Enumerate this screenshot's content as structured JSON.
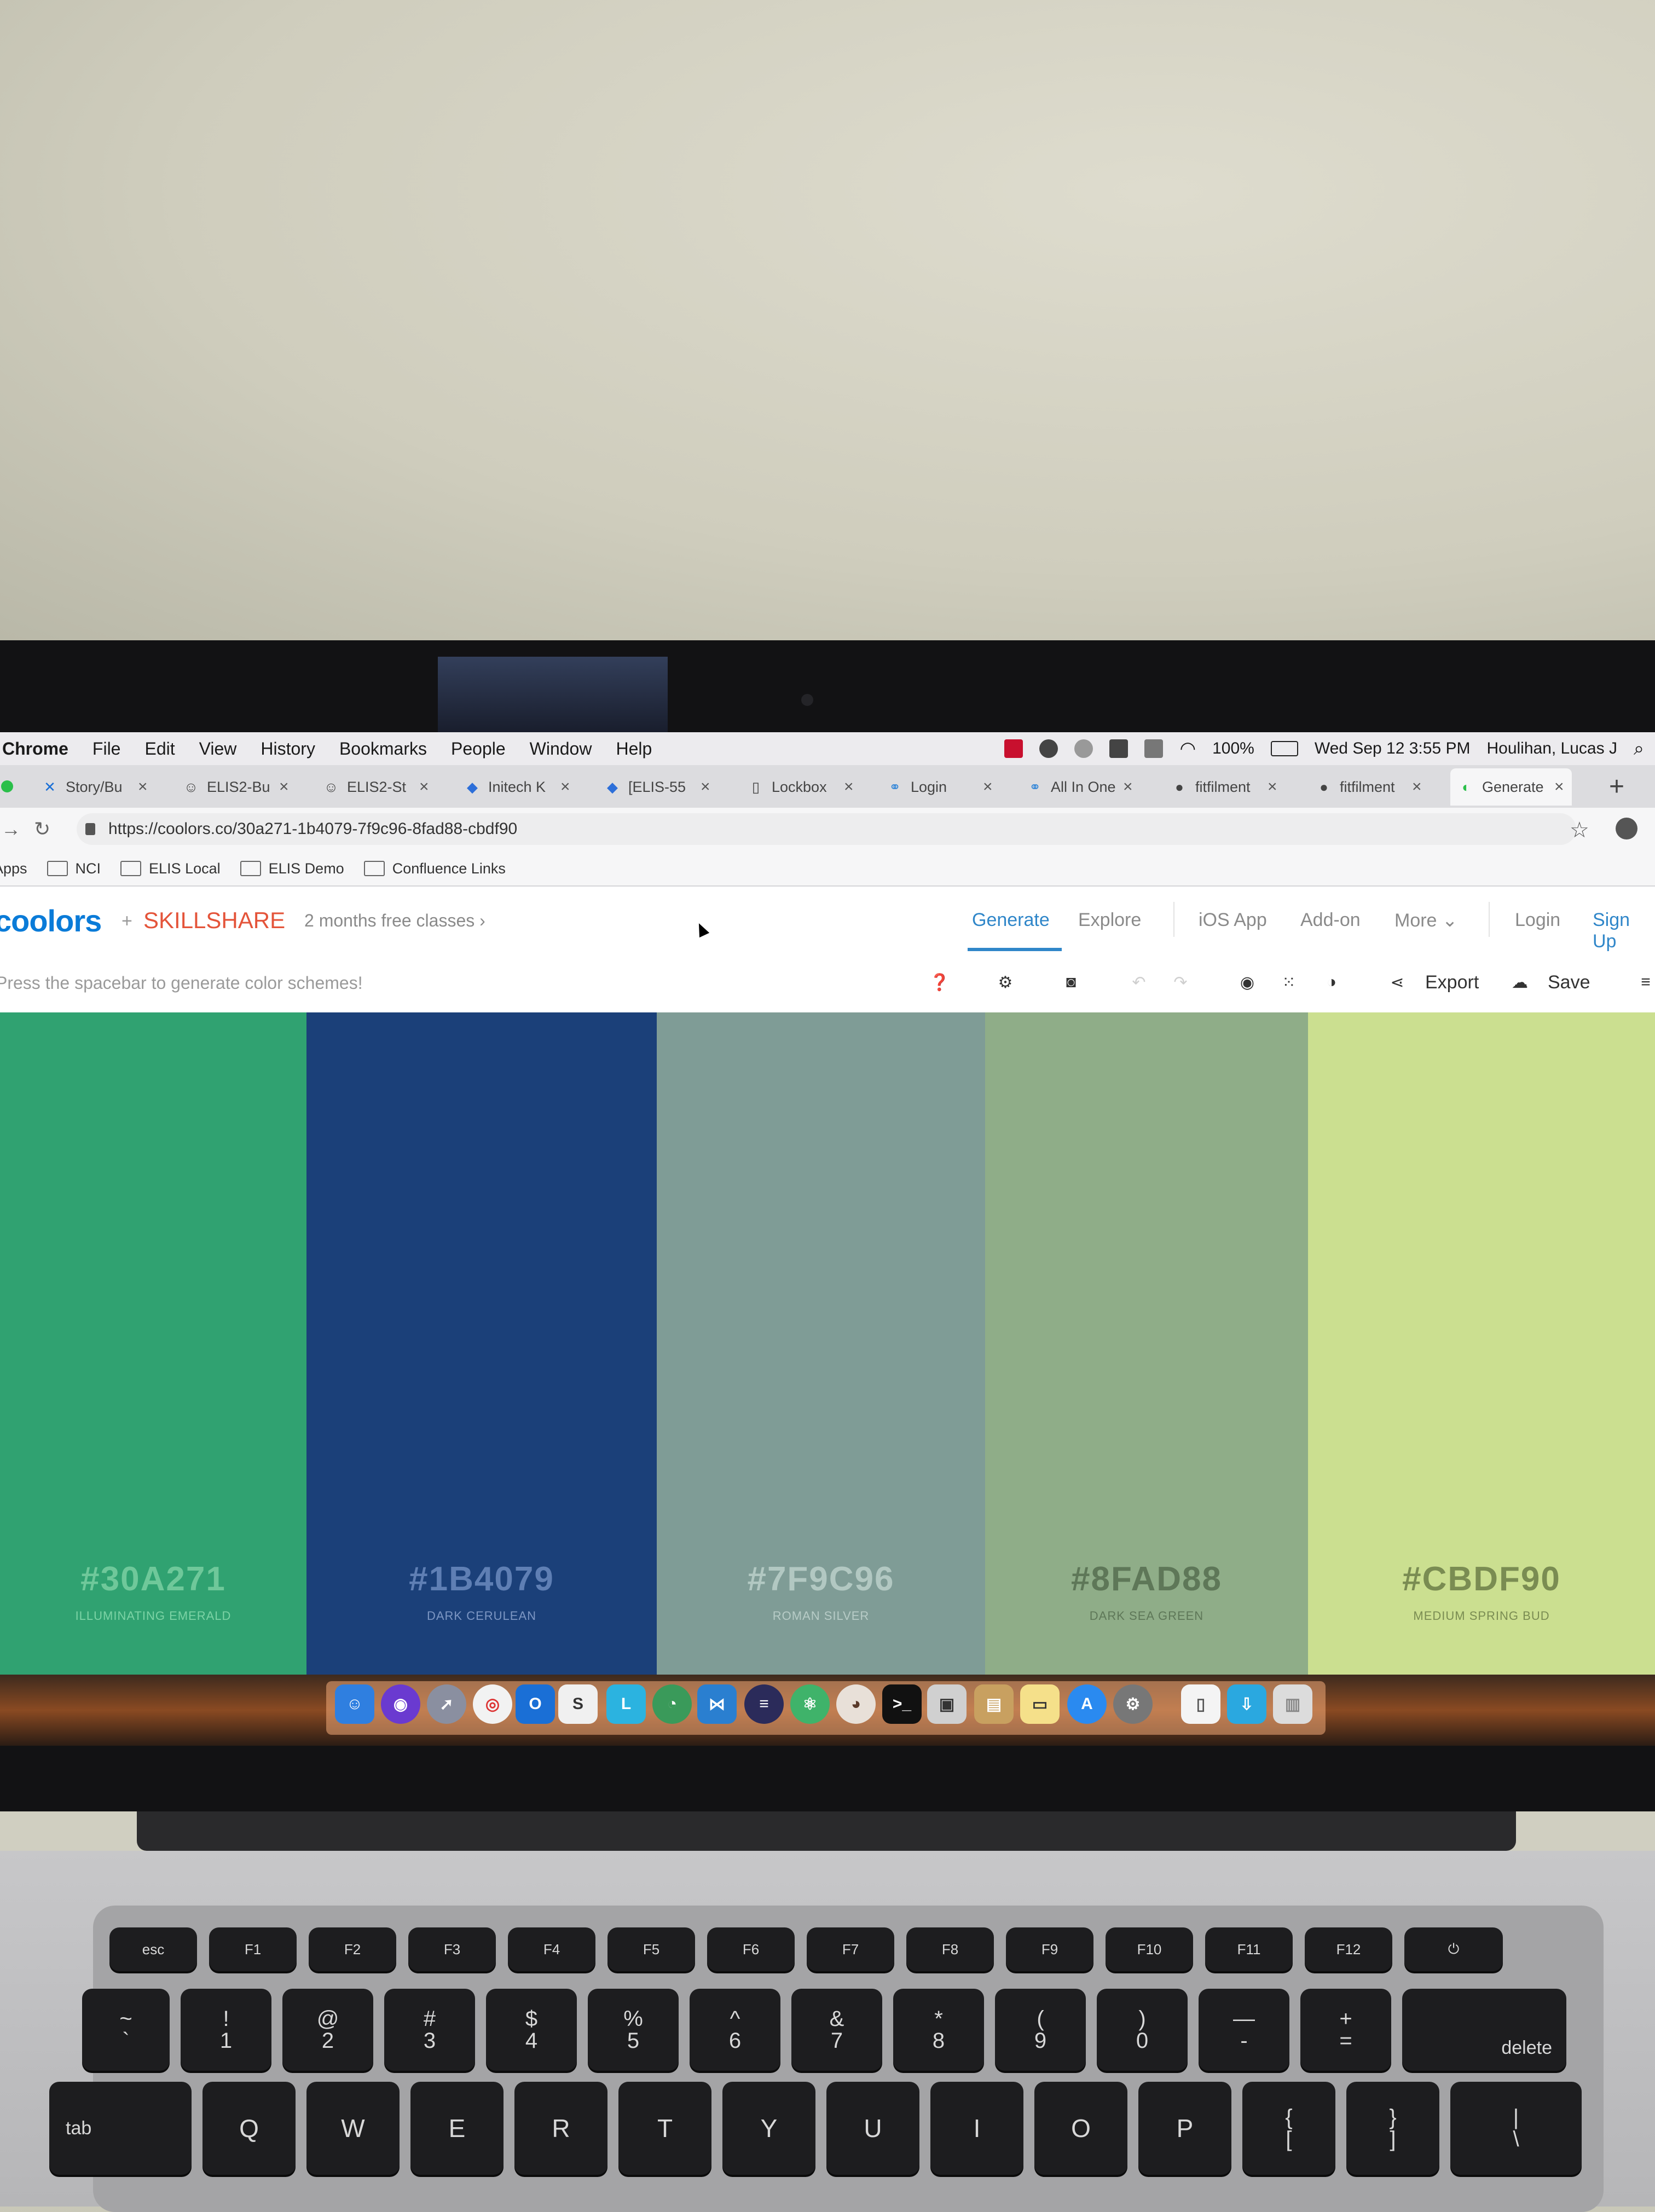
{
  "menubar": {
    "app_name": "Chrome",
    "items": [
      "File",
      "Edit",
      "View",
      "History",
      "Bookmarks",
      "People",
      "Window",
      "Help"
    ],
    "battery": "100%",
    "datetime": "Wed Sep 12  3:55 PM",
    "user": "Houlihan, Lucas J"
  },
  "tabs": [
    {
      "label": "Story/Bu",
      "icon": "confluence-icon"
    },
    {
      "label": "ELIS2-Bu",
      "icon": "avatar-icon"
    },
    {
      "label": "ELIS2-St",
      "icon": "avatar-icon"
    },
    {
      "label": "Initech K",
      "icon": "jira-icon"
    },
    {
      "label": "[ELIS-55",
      "icon": "jira-icon"
    },
    {
      "label": "Lockbox",
      "icon": "document-icon"
    },
    {
      "label": "Login",
      "icon": "link-icon"
    },
    {
      "label": "All In One",
      "icon": "link-icon"
    },
    {
      "label": "fitfilment",
      "icon": "github-icon"
    },
    {
      "label": "fitfilment",
      "icon": "github-icon"
    },
    {
      "label": "Generate",
      "icon": "coolors-icon"
    }
  ],
  "address": {
    "url": "https://coolors.co/30a271-1b4079-7f9c96-8fad88-cbdf90"
  },
  "bookmarks": [
    "Apps",
    "NCI",
    "ELIS Local",
    "ELIS Demo",
    "Confluence Links"
  ],
  "header": {
    "logo": "coolors",
    "plus": "+",
    "partner": "SKILLSHARE",
    "promo": "2 months free classes  ›",
    "nav": [
      "Generate",
      "Explore",
      "iOS App",
      "Add-on",
      "More ⌄",
      "Login",
      "Sign Up"
    ]
  },
  "toolbar": {
    "hint": "Press the spacebar to generate color schemes!",
    "export_label": "Export",
    "save_label": "Save"
  },
  "palette": [
    {
      "hex": "#30A271",
      "name": "ILLUMINATING EMERALD",
      "color": "#30A271"
    },
    {
      "hex": "#1B4079",
      "name": "DARK CERULEAN",
      "color": "#1B4079"
    },
    {
      "hex": "#7F9C96",
      "name": "ROMAN SILVER",
      "color": "#7F9C96"
    },
    {
      "hex": "#8FAD88",
      "name": "DARK SEA GREEN",
      "color": "#8FAD88"
    },
    {
      "hex": "#CBDF90",
      "name": "MEDIUM SPRING BUD",
      "color": "#CBDF90"
    }
  ],
  "keyboard": {
    "fn_row": [
      "esc",
      "F1",
      "F2",
      "F3",
      "F4",
      "F5",
      "F6",
      "F7",
      "F8",
      "F9",
      "F10",
      "F11",
      "F12"
    ],
    "num_row": [
      [
        "~",
        "`"
      ],
      [
        "!",
        "1"
      ],
      [
        "@",
        "2"
      ],
      [
        "#",
        "3"
      ],
      [
        "$",
        "4"
      ],
      [
        "%",
        "5"
      ],
      [
        "^",
        "6"
      ],
      [
        "&",
        "7"
      ],
      [
        "*",
        "8"
      ],
      [
        "(",
        "9"
      ],
      [
        ")",
        "0"
      ],
      [
        "—",
        "-"
      ],
      [
        "+",
        "="
      ]
    ],
    "delete_label": "delete",
    "tab_label": "tab",
    "q_row": [
      "Q",
      "W",
      "E",
      "R",
      "T",
      "Y",
      "U",
      "I",
      "O",
      "P"
    ],
    "brackets": [
      [
        "{",
        "["
      ],
      [
        "}",
        "]"
      ],
      [
        "|",
        "\\"
      ]
    ]
  }
}
